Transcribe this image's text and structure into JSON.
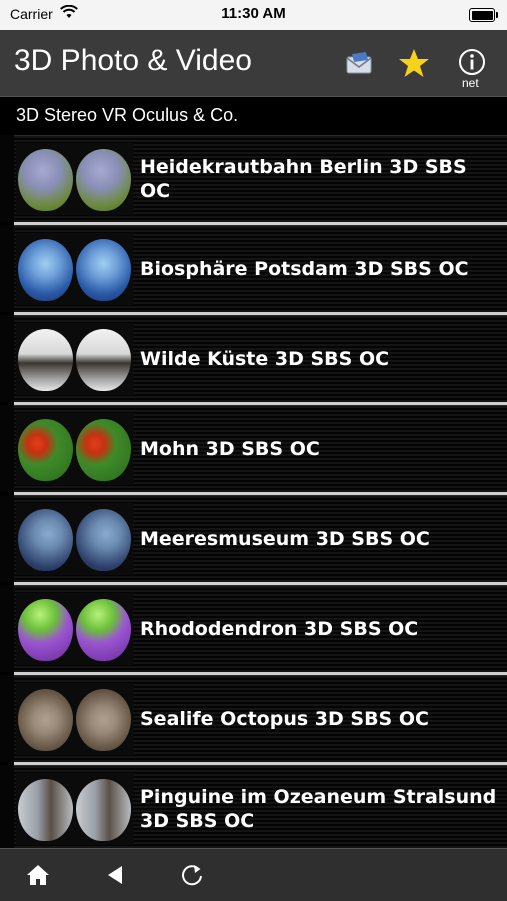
{
  "status_bar": {
    "carrier": "Carrier",
    "time": "11:30 AM"
  },
  "nav": {
    "title": "3D Photo & Video",
    "icons": [
      "mail-icon",
      "star-icon",
      "info-icon"
    ],
    "info_label": "net",
    "colors": {
      "star": "#f7d21b"
    }
  },
  "section": {
    "header": "3D Stereo VR Oculus & Co."
  },
  "list": {
    "items": [
      {
        "label": "Heidekrautbahn Berlin 3D SBS OC",
        "colors": [
          "#8a8fb8",
          "#6c8a3c"
        ]
      },
      {
        "label": "Biosphäre Potsdam 3D SBS OC",
        "colors": [
          "#2a5aa8",
          "#6fa0d8"
        ]
      },
      {
        "label": "Wilde Küste 3D SBS OC",
        "colors": [
          "#e8e8e8",
          "#3a3530"
        ]
      },
      {
        "label": "Mohn 3D SBS OC",
        "colors": [
          "#3f8a2a",
          "#e0401c"
        ]
      },
      {
        "label": "Meeresmuseum 3D SBS OC",
        "colors": [
          "#2c3f6a",
          "#6a8ab0"
        ]
      },
      {
        "label": "Rhododendron 3D SBS OC",
        "colors": [
          "#9a55d0",
          "#6bc03a"
        ]
      },
      {
        "label": "Sealife Octopus 3D SBS OC",
        "colors": [
          "#6a5a4a",
          "#9a8a7a"
        ]
      },
      {
        "label": "Pinguine im Ozeaneum Stralsund 3D SBS OC",
        "colors": [
          "#9aa0a8",
          "#5a5048"
        ]
      }
    ]
  },
  "toolbar": {
    "icons": [
      "home-icon",
      "back-icon",
      "refresh-icon"
    ]
  }
}
